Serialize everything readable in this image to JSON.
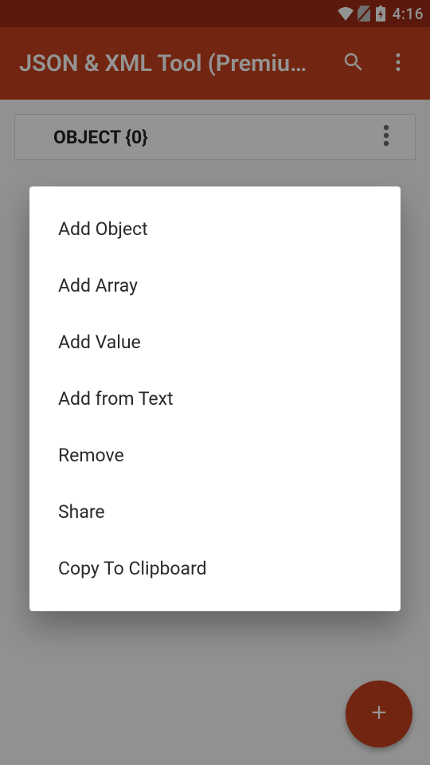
{
  "status": {
    "time": "4:16"
  },
  "appbar": {
    "title": "JSON & XML Tool (Premiu…"
  },
  "card": {
    "title": "OBJECT {0}"
  },
  "menu": {
    "items": [
      {
        "label": "Add Object"
      },
      {
        "label": "Add Array"
      },
      {
        "label": "Add Value"
      },
      {
        "label": "Add from Text"
      },
      {
        "label": "Remove"
      },
      {
        "label": "Share"
      },
      {
        "label": "Copy To Clipboard"
      }
    ]
  }
}
